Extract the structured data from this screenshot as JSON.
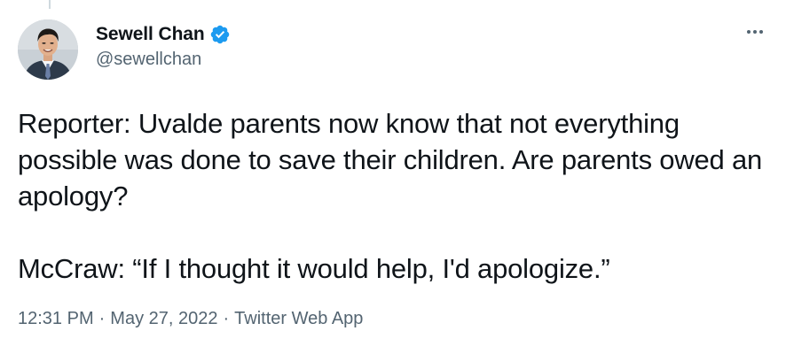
{
  "tweet": {
    "author": {
      "display_name": "Sewell Chan",
      "handle": "@sewellchan",
      "verified": true
    },
    "text_paragraph_1": "Reporter: Uvalde parents now know that not everything possible was done to save their children. Are parents owed an apology?",
    "text_paragraph_2": "McCraw: “If I thought it would help, I'd apologize.”",
    "meta": {
      "time": "12:31 PM",
      "separator": "·",
      "date": "May 27, 2022",
      "source": "Twitter Web App"
    }
  },
  "icons": {
    "verified": "verified-badge-icon",
    "more": "more-options-icon"
  },
  "colors": {
    "text": "#0f1419",
    "secondary": "#536471",
    "verified": "#1d9bf0",
    "thread_line": "#cfd9de"
  }
}
